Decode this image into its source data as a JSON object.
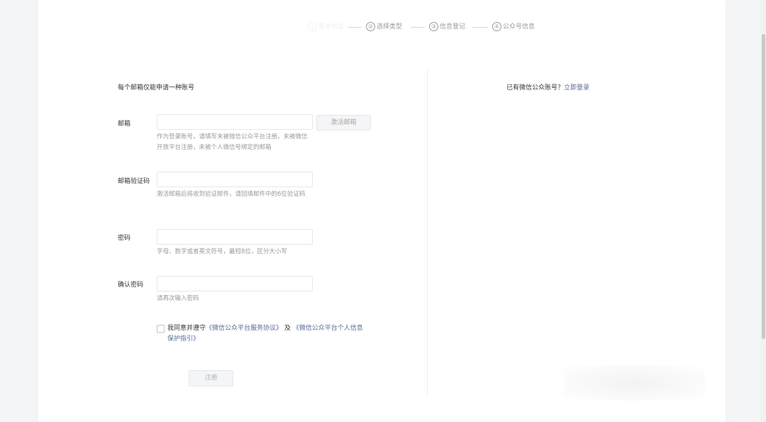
{
  "steps": [
    {
      "num": "①",
      "label": "基本信息"
    },
    {
      "num": "②",
      "label": "选择类型"
    },
    {
      "num": "③",
      "label": "信息登记"
    },
    {
      "num": "④",
      "label": "公众号信息"
    }
  ],
  "note": "每个邮箱仅能申请一种账号",
  "login_hint": {
    "text": "已有微信公众账号？",
    "link": "立即登录"
  },
  "form": {
    "email": {
      "label": "邮箱",
      "value": "",
      "placeholder": "",
      "activate_button": "激活邮箱",
      "tip": "作为登录账号，请填写未被微信公众平台注册，未被微信开放平台注册，未被个人微信号绑定的邮箱"
    },
    "email_code": {
      "label": "邮箱验证码",
      "value": "",
      "placeholder": "",
      "tip": "激活邮箱后将收到验证邮件，请回填邮件中的6位验证码"
    },
    "password": {
      "label": "密码",
      "value": "",
      "placeholder": "",
      "tip": "字母、数字或者英文符号，最短8位，区分大小写"
    },
    "confirm_password": {
      "label": "确认密码",
      "value": "",
      "placeholder": "",
      "tip": "请再次输入密码"
    },
    "agreement": {
      "prefix": "我同意并遵守",
      "link1": "《微信公众平台服务协议》",
      "and": " 及 ",
      "link2": "《微信公众平台个人信息保护指引》",
      "checked": false
    },
    "register_button": "注册"
  },
  "colors": {
    "link": "#576b95",
    "muted": "#9a9a9a",
    "border": "#e4e8eb"
  }
}
